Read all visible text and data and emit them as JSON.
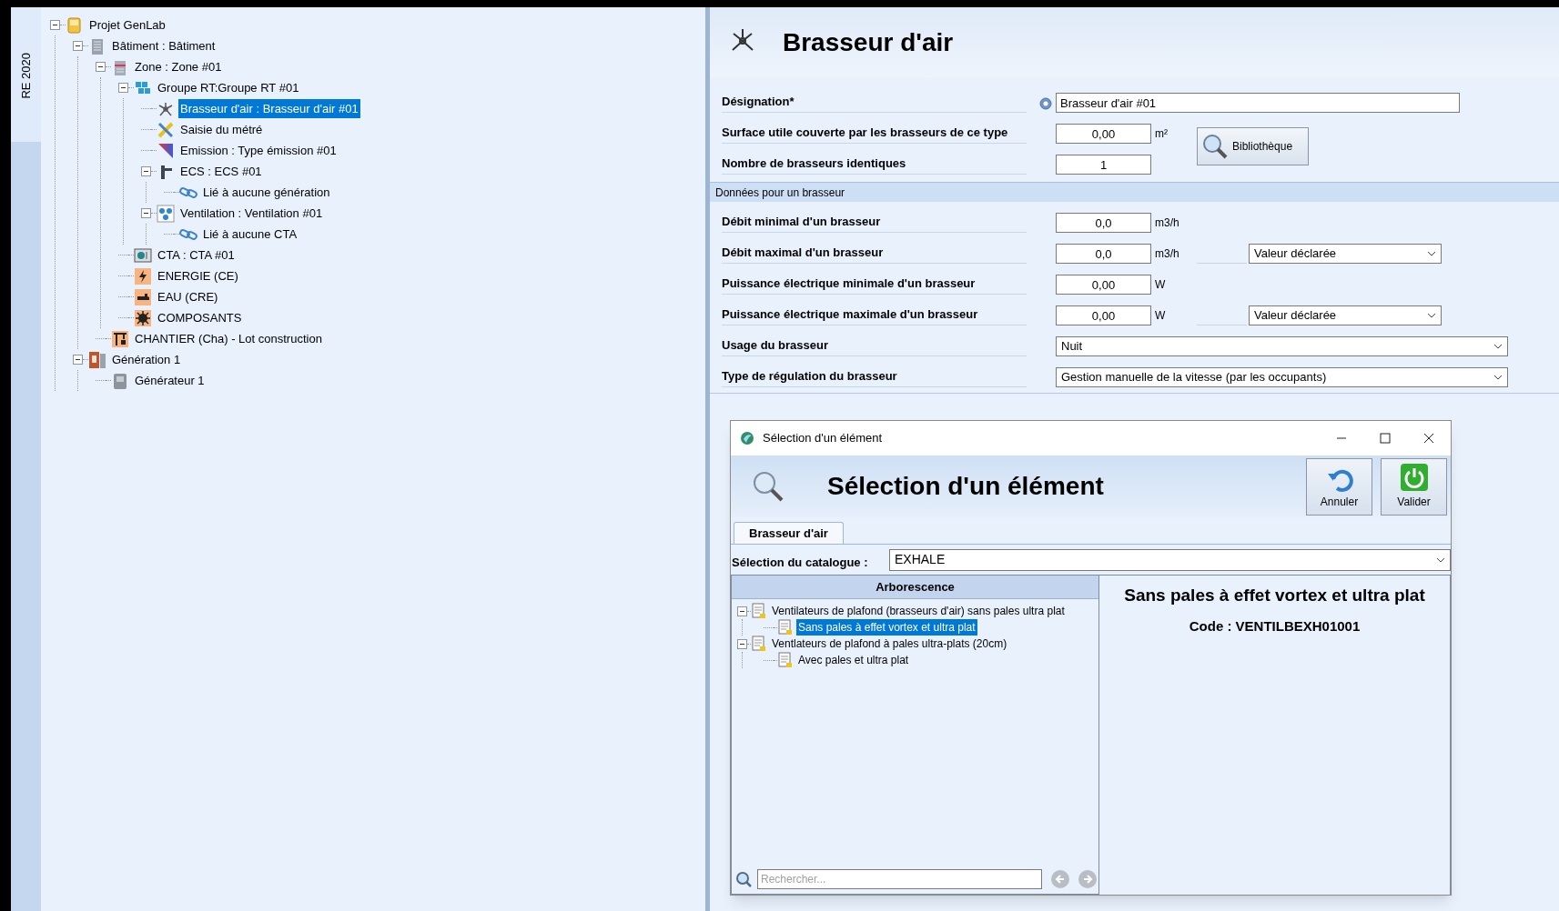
{
  "side_tab": {
    "label": "RE 2020",
    "selected": true
  },
  "tree": [
    {
      "kind": "project",
      "label": "Projet GenLab",
      "selected": false,
      "expanded": true,
      "children": [
        {
          "kind": "building",
          "label": "Bâtiment : Bâtiment",
          "selected": false,
          "expanded": true,
          "children": [
            {
              "kind": "zone",
              "label": "Zone : Zone #01",
              "selected": false,
              "expanded": true,
              "children": [
                {
                  "kind": "group",
                  "label": "Groupe RT:Groupe RT #01",
                  "selected": false,
                  "expanded": true,
                  "children": [
                    {
                      "kind": "fan",
                      "label": "Brasseur d'air : Brasseur d'air #01",
                      "selected": true
                    },
                    {
                      "kind": "measure",
                      "label": "Saisie du métré",
                      "selected": false
                    },
                    {
                      "kind": "emission",
                      "label": "Emission : Type émission #01",
                      "selected": false
                    },
                    {
                      "kind": "ecs",
                      "label": "ECS : ECS #01",
                      "selected": false,
                      "expanded": true,
                      "children": [
                        {
                          "kind": "link",
                          "label": "Lié à aucune génération",
                          "selected": false
                        }
                      ]
                    },
                    {
                      "kind": "ventilation",
                      "label": "Ventilation : Ventilation #01",
                      "selected": false,
                      "expanded": true,
                      "children": [
                        {
                          "kind": "link",
                          "label": "Lié à aucune CTA",
                          "selected": false
                        }
                      ]
                    }
                  ]
                },
                {
                  "kind": "cta",
                  "label": "CTA : CTA #01",
                  "selected": false
                },
                {
                  "kind": "energy",
                  "label": "ENERGIE (CE)",
                  "selected": false
                },
                {
                  "kind": "water",
                  "label": "EAU (CRE)",
                  "selected": false
                },
                {
                  "kind": "components",
                  "label": "COMPOSANTS",
                  "selected": false
                }
              ]
            },
            {
              "kind": "site",
              "label": "CHANTIER (Cha) - Lot construction",
              "selected": false
            }
          ]
        },
        {
          "kind": "generation",
          "label": "Génération 1",
          "selected": false,
          "expanded": true,
          "children": [
            {
              "kind": "generator",
              "label": "Générateur 1",
              "selected": false
            }
          ]
        }
      ]
    }
  ],
  "form": {
    "title": "Brasseur d'air",
    "fields": [
      {
        "kind": "text",
        "label": "Désignation*",
        "value": "Brasseur d'air #01"
      },
      {
        "kind": "number",
        "label": "Surface utile couverte par les brasseurs de ce type",
        "value": "0,00",
        "unit": "m²"
      },
      {
        "kind": "number",
        "label": "Nombre de brasseurs identiques",
        "value": "1"
      }
    ],
    "library_button": "Bibliothèque",
    "section": {
      "title": "Données pour un brasseur",
      "fields": [
        {
          "kind": "number",
          "label": "Débit minimal d'un brasseur",
          "value": "0,0",
          "unit": "m3/h"
        },
        {
          "kind": "number",
          "label": "Débit maximal d'un brasseur",
          "value": "0,0",
          "unit": "m3/h",
          "option": "Valeur déclarée"
        },
        {
          "kind": "number",
          "label": "Puissance électrique minimale d'un brasseur",
          "value": "0,00",
          "unit": "W"
        },
        {
          "kind": "number",
          "label": "Puissance électrique maximale d'un brasseur",
          "value": "0,00",
          "unit": "W",
          "option": "Valeur déclarée"
        },
        {
          "kind": "select",
          "label": "Usage du brasseur",
          "value": "Nuit"
        },
        {
          "kind": "select",
          "label": "Type de régulation du brasseur",
          "value": "Gestion manuelle de la vitesse (par les occupants)"
        }
      ]
    }
  },
  "dialog": {
    "title": "Sélection d'un élément",
    "heading": "Sélection d'un élément",
    "buttons": [
      {
        "kind": "undo",
        "label": "Annuler"
      },
      {
        "kind": "power",
        "label": "Valider"
      }
    ],
    "tabs": [
      {
        "label": "Brasseur d'air",
        "selected": true
      }
    ],
    "catalogue": {
      "label": "Sélection du catalogue :",
      "value": "EXHALE"
    },
    "tree": {
      "header": "Arborescence",
      "nodes": [
        {
          "label": "Ventilateurs de plafond (brasseurs d'air) sans pales ultra plat",
          "selected": false,
          "expanded": true,
          "children": [
            {
              "label": "Sans pales à effet vortex et ultra plat",
              "selected": true
            }
          ]
        },
        {
          "label": "Ventlateurs de plafond à pales ultra-plats (20cm)",
          "selected": false,
          "expanded": true,
          "children": [
            {
              "label": "Avec pales et ultra plat",
              "selected": false
            }
          ]
        }
      ]
    },
    "detail": {
      "title": "Sans pales à effet vortex et ultra plat",
      "code": "Code : VENTILBEXH01001"
    },
    "search": {
      "placeholder": "Rechercher..."
    }
  }
}
